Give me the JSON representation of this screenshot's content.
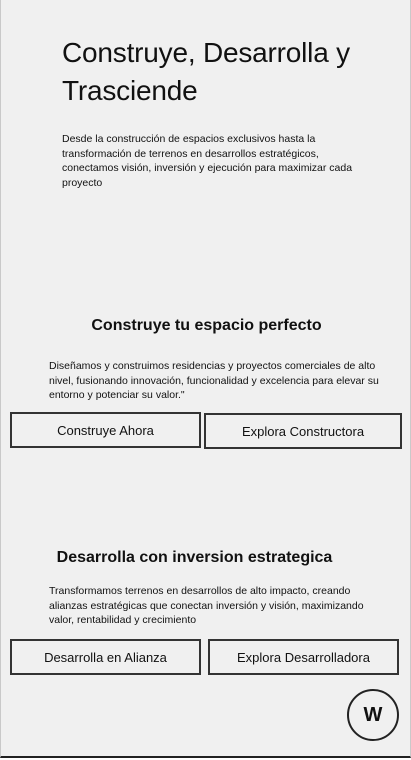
{
  "hero": {
    "title": "Construye, Desarrolla y Trasciende",
    "description": "Desde la construcción de espacios exclusivos hasta la transformación de terrenos en desarrollos estratégicos, conectamos visión, inversión y ejecución para maximizar cada proyecto"
  },
  "construye": {
    "title": "Construye tu espacio perfecto",
    "description": "Diseñamos y construimos residencias y proyectos comerciales de alto nivel, fusionando innovación, funcionalidad y excelencia para elevar su entorno y potenciar su valor.\"",
    "primary_button": "Construye Ahora",
    "secondary_button": "Explora Constructora"
  },
  "desarrolla": {
    "title": "Desarrolla con inversion estrategica",
    "description": "Transformamos terrenos en desarrollos de alto impacto, creando alianzas estratégicas que conectan inversión y visión, maximizando valor, rentabilidad y crecimiento",
    "primary_button": "Desarrolla en Alianza",
    "secondary_button": "Explora Desarrolladora"
  },
  "fab": {
    "label": "W"
  }
}
